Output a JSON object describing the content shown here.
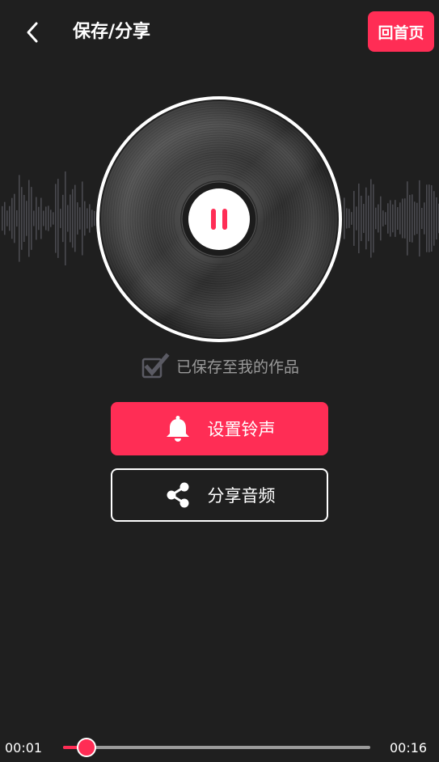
{
  "header": {
    "title": "保存/分享",
    "home_label": "回首页",
    "back_icon": "chevron-left-icon"
  },
  "player": {
    "state": "playing",
    "control_icon": "pause-icon"
  },
  "saved": {
    "text": "已保存至我的作品",
    "checked": true
  },
  "actions": {
    "ringtone_label": "设置铃声",
    "ringtone_icon": "bell-icon",
    "share_label": "分享音频",
    "share_icon": "share-icon"
  },
  "progress": {
    "current": "00:01",
    "total": "00:16",
    "fraction": 0.075
  },
  "colors": {
    "accent": "#ff2d55",
    "background": "#1f1f1f"
  }
}
